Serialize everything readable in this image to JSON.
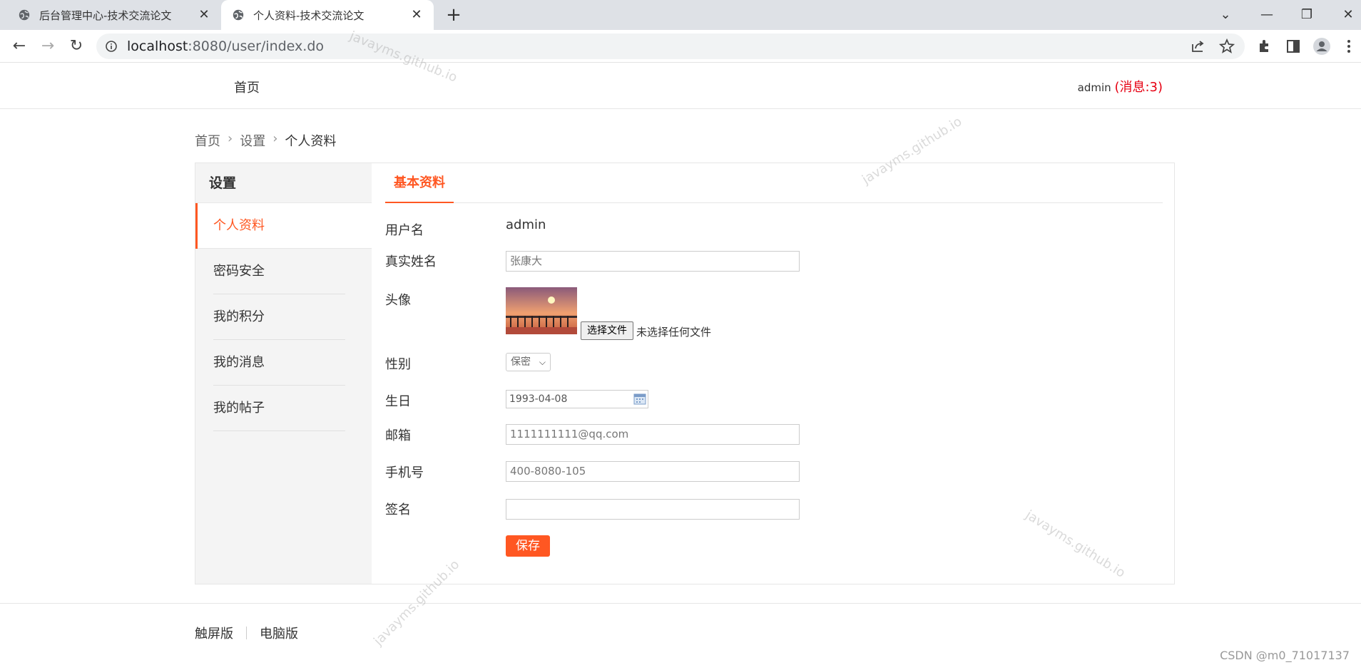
{
  "browser": {
    "tabs": [
      {
        "title": "后台管理中心-技术交流论文",
        "active": false
      },
      {
        "title": "个人资料-技术交流论文",
        "active": true
      }
    ],
    "url_host": "localhost",
    "url_path": ":8080/user/index.do"
  },
  "header": {
    "home_label": "首页",
    "username": "admin",
    "messages_label": "(消息:3)"
  },
  "breadcrumb": [
    "首页",
    "设置",
    "个人资料"
  ],
  "breadcrumb_sep": "›",
  "sidebar": {
    "title": "设置",
    "items": [
      {
        "label": "个人资料",
        "active": true
      },
      {
        "label": "密码安全"
      },
      {
        "label": "我的积分"
      },
      {
        "label": "我的消息"
      },
      {
        "label": "我的帖子"
      }
    ]
  },
  "main": {
    "tab_label": "基本资料",
    "form": {
      "username_label": "用户名",
      "username_value": "admin",
      "realname_label": "真实姓名",
      "realname_value": "张康大",
      "avatar_label": "头像",
      "file_button": "选择文件",
      "file_status": "未选择任何文件",
      "gender_label": "性别",
      "gender_value": "保密",
      "birthday_label": "生日",
      "birthday_value": "1993-04-08",
      "email_label": "邮箱",
      "email_value": "1111111111@qq.com",
      "phone_label": "手机号",
      "phone_value": "400-8080-105",
      "signature_label": "签名",
      "signature_value": "",
      "save_button": "保存"
    }
  },
  "footer": {
    "links": [
      "触屏版",
      "电脑版"
    ]
  },
  "watermark": "javayms.github.io",
  "credit": "CSDN @m0_71017137",
  "colors": {
    "accent": "#ff5722",
    "message": "#e60012"
  }
}
